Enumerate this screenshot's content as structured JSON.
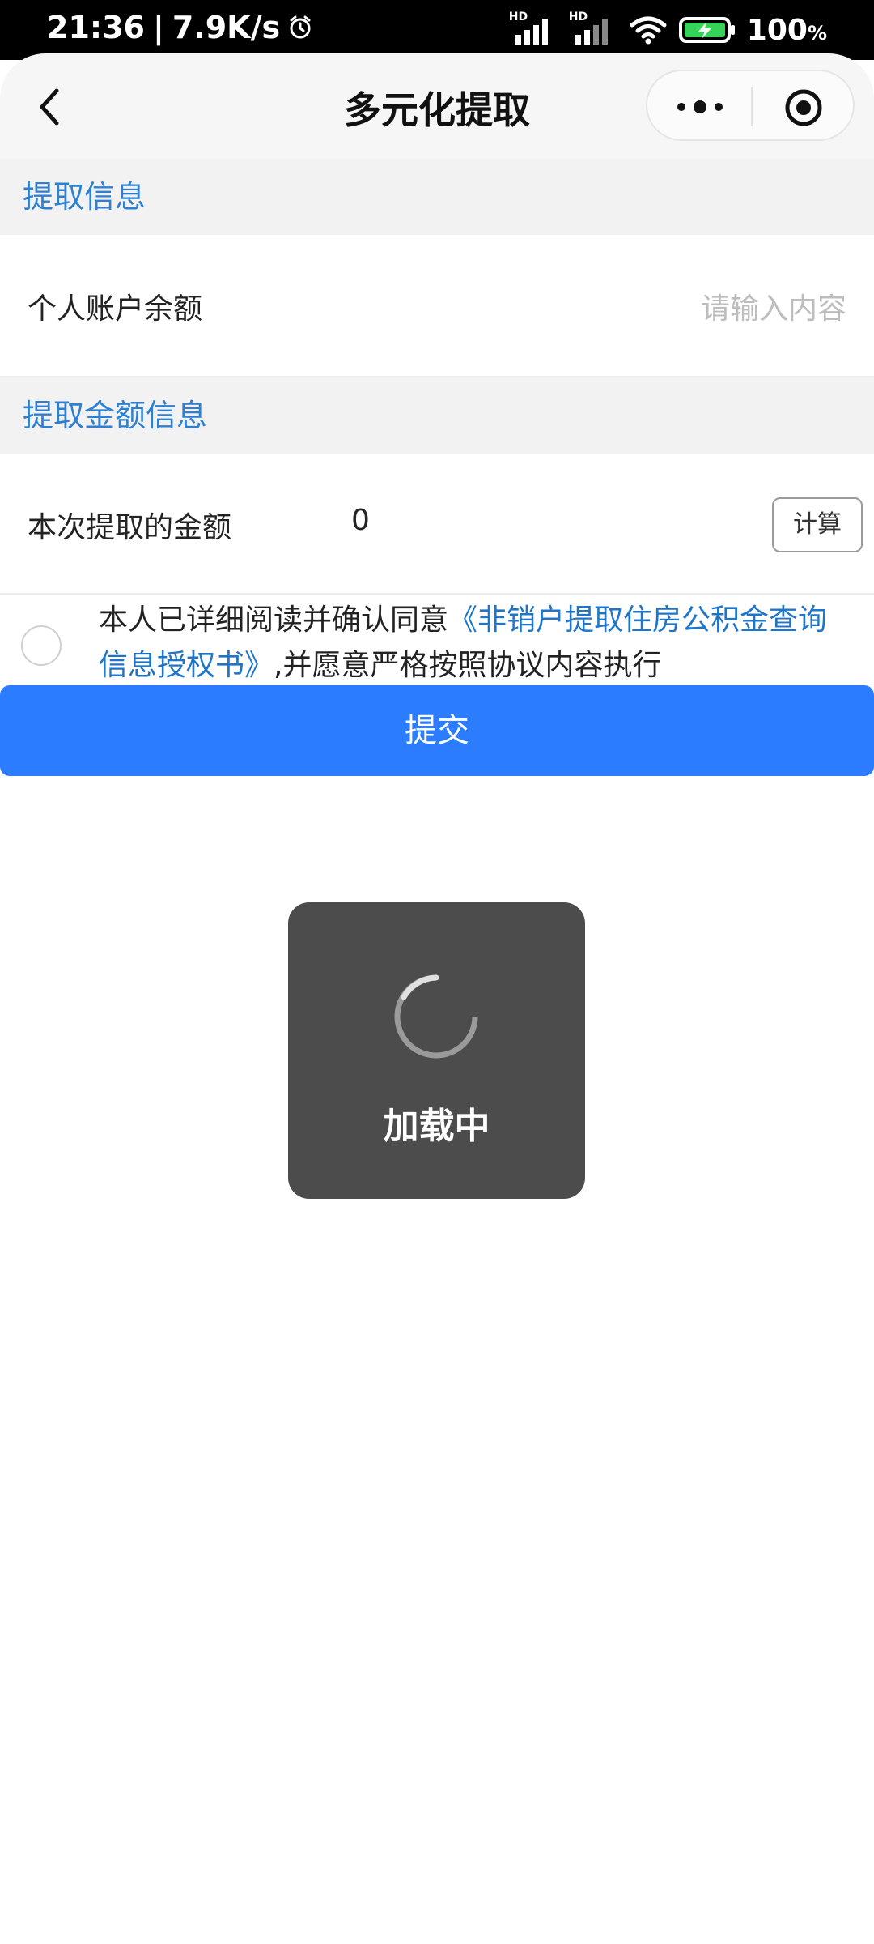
{
  "status_bar": {
    "time": "21:36",
    "speed": "7.9K/s",
    "battery": "100",
    "battery_unit": "%",
    "signal_tag_1": "HD",
    "signal_tag_2": "HD",
    "icons": [
      "alarm-icon",
      "signal-icon",
      "signal-icon",
      "wifi-icon",
      "battery-charging-icon"
    ]
  },
  "navbar": {
    "title": "多元化提取",
    "back_icon": "chevron-left-icon",
    "more_icon": "more-dots-icon",
    "close_icon": "target-circle-icon"
  },
  "sections": {
    "info_title": "提取信息",
    "amount_title": "提取金额信息"
  },
  "fields": {
    "balance_label": "个人账户余额",
    "balance_placeholder": "请输入内容",
    "amount_label": "本次提取的金额",
    "amount_value": "0",
    "calc_label": "计算"
  },
  "agreement": {
    "prefix": "本人已详细阅读并确认同意",
    "link": "《非销户提取住房公积金查询信息授权书》",
    "suffix": ",并愿意严格按照协议内容执行"
  },
  "submit_label": "提交",
  "toast": {
    "text": "加载中"
  },
  "colors": {
    "accent": "#2b7cff",
    "link": "#1f76c8",
    "section_text": "#2f7fd1",
    "toast_bg": "#4c4c4c"
  }
}
